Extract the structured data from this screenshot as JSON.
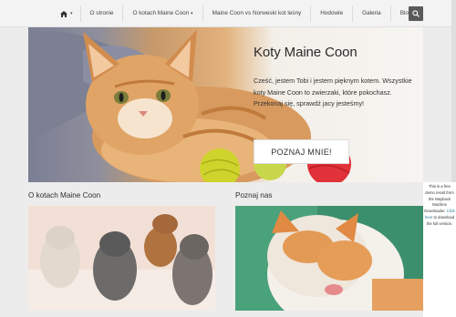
{
  "nav": {
    "home_label": "",
    "items": [
      {
        "label": "O stronie"
      },
      {
        "label": "O kotach Maine Coon"
      },
      {
        "label": "Maine Coon vs Norweski kot leśny"
      },
      {
        "label": "Hodowle"
      },
      {
        "label": "Galeria"
      },
      {
        "label": "Blog"
      }
    ]
  },
  "hero": {
    "title": "Koty Maine Coon",
    "text": "Cześć, jestem Tobi i jestem pięknym kotem. Wszystkie koty Maine Coon to zwierzaki, które pokochasz. Przekonaj się, sprawdź jacy jesteśmy!",
    "button_label": "POZNAJ MNIE!"
  },
  "sections": {
    "left_title": "O kotach Maine Coon",
    "right_title": "Poznaj nas"
  },
  "notice": {
    "text_before": "This is a free demo result from the Wayback Machine Downloader.",
    "link_text": "Click here",
    "text_after": "to download the full version."
  },
  "colors": {
    "nav_bg": "#f3f3f3",
    "search_bg": "#5a5a5a",
    "page_bg": "#ececec",
    "link": "#2a7a9a"
  },
  "icons": {
    "home": "home-icon",
    "search": "search-icon",
    "caret": "chevron-down-icon"
  }
}
